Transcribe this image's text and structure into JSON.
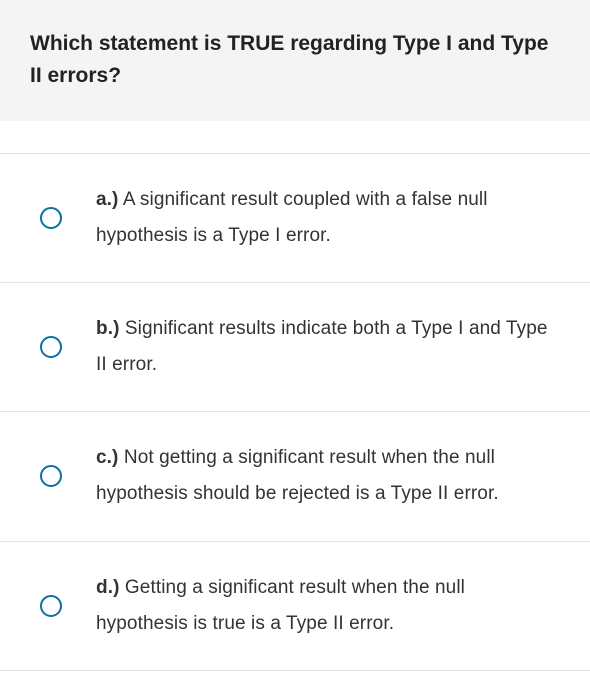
{
  "question": {
    "title": "Which statement is TRUE regarding Type I and Type II errors?"
  },
  "options": [
    {
      "letter": "a.)",
      "text": "A significant result coupled with a false null hypothesis is a Type I error."
    },
    {
      "letter": "b.)",
      "text": "Significant results indicate both a Type I and Type II error."
    },
    {
      "letter": "c.)",
      "text": "Not getting a significant result when the null hypothesis should be rejected is a Type II error."
    },
    {
      "letter": "d.)",
      "text": "Getting a significant result when the null hypothesis is true is a Type II error."
    }
  ]
}
